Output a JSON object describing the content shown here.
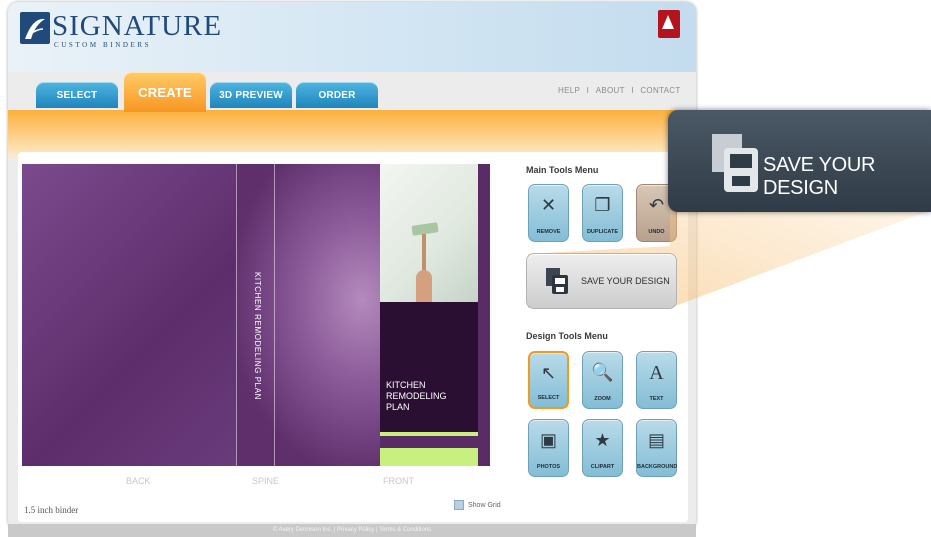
{
  "brand": {
    "title": "SIGNATURE",
    "subtitle": "CUSTOM BINDERS"
  },
  "tabs": [
    {
      "label": "SELECT"
    },
    {
      "label": "CREATE"
    },
    {
      "label": "3D PREVIEW"
    },
    {
      "label": "ORDER"
    }
  ],
  "top_links": {
    "help": "HELP",
    "about": "ABOUT",
    "contact": "CONTACT",
    "separator": "I"
  },
  "binder": {
    "spine_text": "KITCHEN REMODELING PLAN",
    "front_text": "KITCHEN REMODELING PLAN",
    "labels": {
      "back": "BACK",
      "spine": "SPINE",
      "front": "FRONT"
    },
    "size": "1.5 inch binder"
  },
  "show_grid": "Show Grid",
  "main_tools": {
    "title": "Main Tools Menu",
    "items": [
      {
        "label": "REMOVE",
        "icon": "remove-icon"
      },
      {
        "label": "DUPLICATE",
        "icon": "duplicate-icon"
      },
      {
        "label": "UNDO",
        "icon": "undo-icon"
      }
    ],
    "save": {
      "label": "SAVE YOUR DESIGN",
      "icon": "save-icon"
    }
  },
  "design_tools": {
    "title": "Design Tools Menu",
    "items": [
      {
        "label": "SELECT",
        "icon": "cursor-icon"
      },
      {
        "label": "ZOOM",
        "icon": "zoom-icon"
      },
      {
        "label": "TEXT",
        "icon": "text-icon"
      },
      {
        "label": "PHOTOS",
        "icon": "photos-icon"
      },
      {
        "label": "CLIPART",
        "icon": "clipart-icon"
      },
      {
        "label": "BACKGROUND",
        "icon": "paint-roller-icon"
      }
    ]
  },
  "callout": {
    "label": "SAVE YOUR DESIGN"
  },
  "footer": {
    "text": "© Avery Dennison Inc. | Privacy Policy | Terms & Conditions"
  },
  "colors": {
    "tab_blue": "#1f86bd",
    "tab_active": "#f79622",
    "binder_purple": "#5e2d6a",
    "accent_green": "#c8f07e"
  }
}
